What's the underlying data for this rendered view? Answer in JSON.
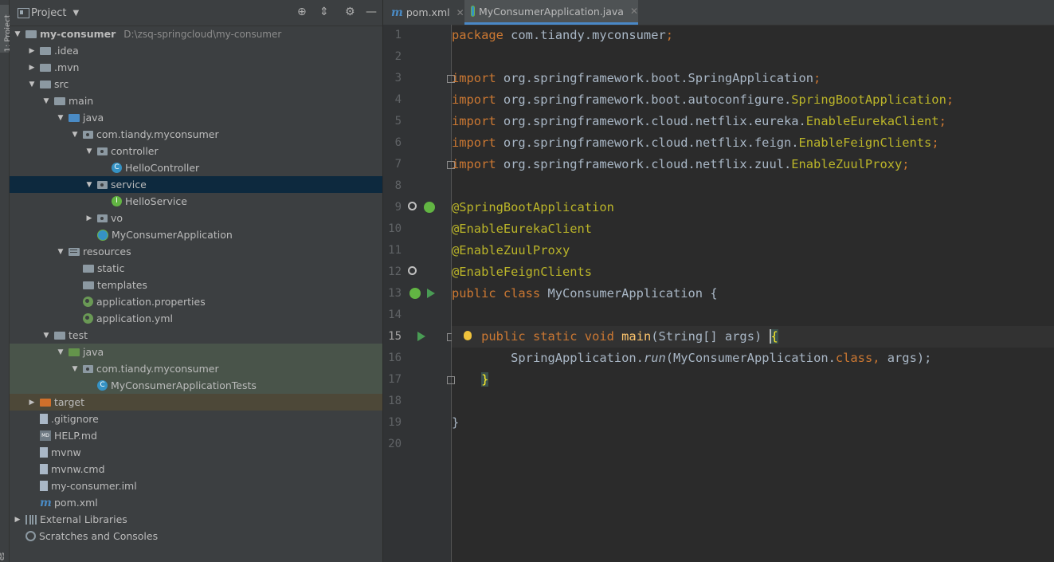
{
  "toolstrip": {
    "label": "1: Project",
    "bottom_label": "es"
  },
  "project_panel": {
    "title": "Project",
    "tree": [
      {
        "label": "my-consumer",
        "path": "D:\\zsq-springcloud\\my-consumer",
        "depth": 0,
        "arrow": "down",
        "icon": "module-folder-icon"
      },
      {
        "label": ".idea",
        "depth": 1,
        "arrow": "right",
        "icon": "folder-icon"
      },
      {
        "label": ".mvn",
        "depth": 1,
        "arrow": "right",
        "icon": "folder-icon"
      },
      {
        "label": "src",
        "depth": 1,
        "arrow": "down",
        "icon": "folder-icon"
      },
      {
        "label": "main",
        "depth": 2,
        "arrow": "down",
        "icon": "folder-icon"
      },
      {
        "label": "java",
        "depth": 3,
        "arrow": "down",
        "icon": "source-folder-icon"
      },
      {
        "label": "com.tiandy.myconsumer",
        "depth": 4,
        "arrow": "down",
        "icon": "package-icon"
      },
      {
        "label": "controller",
        "depth": 5,
        "arrow": "down",
        "icon": "package-icon"
      },
      {
        "label": "HelloController",
        "depth": 6,
        "arrow": "none",
        "icon": "class-icon"
      },
      {
        "label": "service",
        "depth": 5,
        "arrow": "down",
        "icon": "package-icon",
        "selected": true
      },
      {
        "label": "HelloService",
        "depth": 6,
        "arrow": "none",
        "icon": "interface-icon"
      },
      {
        "label": "vo",
        "depth": 5,
        "arrow": "right",
        "icon": "package-icon"
      },
      {
        "label": "MyConsumerApplication",
        "depth": 5,
        "arrow": "none",
        "icon": "spring-boot-class-icon"
      },
      {
        "label": "resources",
        "depth": 3,
        "arrow": "down",
        "icon": "resources-folder-icon"
      },
      {
        "label": "static",
        "depth": 4,
        "arrow": "none",
        "icon": "folder-icon"
      },
      {
        "label": "templates",
        "depth": 4,
        "arrow": "none",
        "icon": "folder-icon"
      },
      {
        "label": "application.properties",
        "depth": 4,
        "arrow": "none",
        "icon": "spring-config-icon"
      },
      {
        "label": "application.yml",
        "depth": 4,
        "arrow": "none",
        "icon": "spring-config-icon"
      },
      {
        "label": "test",
        "depth": 2,
        "arrow": "down",
        "icon": "folder-icon"
      },
      {
        "label": "java",
        "depth": 3,
        "arrow": "down",
        "icon": "test-folder-icon",
        "bg": "test"
      },
      {
        "label": "com.tiandy.myconsumer",
        "depth": 4,
        "arrow": "down",
        "icon": "package-icon",
        "bg": "test"
      },
      {
        "label": "MyConsumerApplicationTests",
        "depth": 5,
        "arrow": "none",
        "icon": "class-icon",
        "bg": "test"
      },
      {
        "label": "target",
        "depth": 1,
        "arrow": "right",
        "icon": "excluded-folder-icon",
        "bg": "excluded"
      },
      {
        "label": ".gitignore",
        "depth": 1,
        "arrow": "none",
        "icon": "file-icon"
      },
      {
        "label": "HELP.md",
        "depth": 1,
        "arrow": "none",
        "icon": "markdown-icon"
      },
      {
        "label": "mvnw",
        "depth": 1,
        "arrow": "none",
        "icon": "file-icon"
      },
      {
        "label": "mvnw.cmd",
        "depth": 1,
        "arrow": "none",
        "icon": "file-icon"
      },
      {
        "label": "my-consumer.iml",
        "depth": 1,
        "arrow": "none",
        "icon": "file-icon"
      },
      {
        "label": "pom.xml",
        "depth": 1,
        "arrow": "none",
        "icon": "maven-icon"
      },
      {
        "label": "External Libraries",
        "depth": 0,
        "arrow": "right",
        "icon": "library-icon"
      },
      {
        "label": "Scratches and Consoles",
        "depth": 0,
        "arrow": "none",
        "icon": "scratch-icon"
      }
    ]
  },
  "editor": {
    "tabs": [
      {
        "label": "pom.xml",
        "active": false,
        "icon": "maven-icon"
      },
      {
        "label": "MyConsumerApplication.java",
        "active": true,
        "icon": "spring-boot-class-icon"
      }
    ],
    "line_numbers": [
      "1",
      "2",
      "3",
      "4",
      "5",
      "6",
      "7",
      "8",
      "9",
      "10",
      "11",
      "12",
      "13",
      "14",
      "15",
      "16",
      "17",
      "18",
      "19",
      "20"
    ],
    "current_line": "15",
    "code": {
      "l1": {
        "kw": "package",
        "rest": " com.tiandy.myconsumer",
        "semi": ";"
      },
      "l3": {
        "kw": "import",
        "pkg": " org.springframework.boot.SpringApplication",
        "semi": ";"
      },
      "l4": {
        "kw": "import",
        "pkg": " org.springframework.boot.autoconfigure.",
        "cls": "SpringBootApplication",
        "semi": ";"
      },
      "l5": {
        "kw": "import",
        "pkg": " org.springframework.cloud.netflix.eureka.",
        "cls": "EnableEurekaClient",
        "semi": ";"
      },
      "l6": {
        "kw": "import",
        "pkg": " org.springframework.cloud.netflix.feign.",
        "cls": "EnableFeignClients",
        "semi": ";"
      },
      "l7": {
        "kw": "import",
        "pkg": " org.springframework.cloud.netflix.zuul.",
        "cls": "EnableZuulProxy",
        "semi": ";"
      },
      "l9": {
        "ann": "@SpringBootApplication"
      },
      "l10": {
        "ann": "@EnableEurekaClient"
      },
      "l11": {
        "ann": "@EnableZuulProxy"
      },
      "l12": {
        "ann": "@EnableFeignClients"
      },
      "l13": {
        "kw": "public class",
        "rest": " MyConsumerApplication {"
      },
      "l15": {
        "indent": "    ",
        "kw": "public static void",
        "sp": " ",
        "fn": "main",
        "rest": "(String[] args) ",
        "brace": "{"
      },
      "l16": {
        "indent": "        ",
        "a": "SpringApplication.",
        "fn": "run",
        "b": "(MyConsumerApplication.",
        "kw": "class",
        "c": ",",
        "d": " args);"
      },
      "l17": {
        "indent": "    ",
        "brace": "}"
      },
      "l19": {
        "rest": "}"
      }
    }
  }
}
